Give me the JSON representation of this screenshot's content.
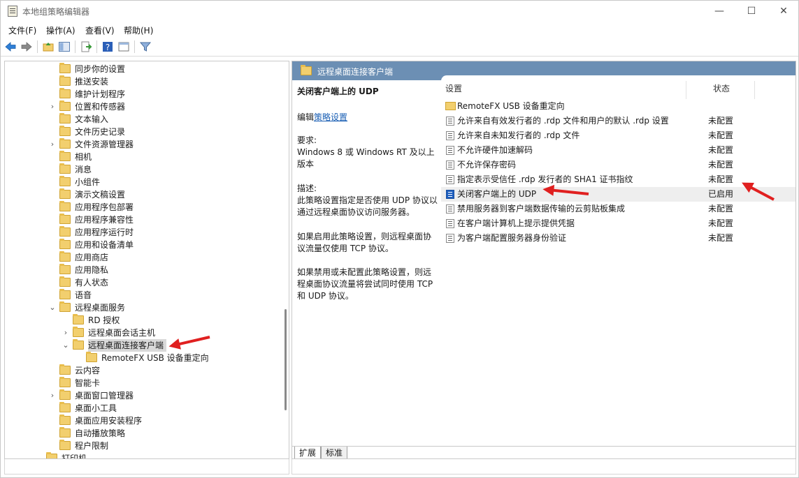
{
  "window": {
    "title": "本地组策略编辑器",
    "minimize": "—",
    "maximize": "☐",
    "close": "✕"
  },
  "menu": [
    {
      "label": "文件(F)"
    },
    {
      "label": "操作(A)"
    },
    {
      "label": "查看(V)"
    },
    {
      "label": "帮助(H)"
    }
  ],
  "tree": {
    "items": [
      {
        "label": "同步你的设置",
        "expander": ""
      },
      {
        "label": "推送安装",
        "expander": ""
      },
      {
        "label": "维护计划程序",
        "expander": ""
      },
      {
        "label": "位置和传感器",
        "expander": "›"
      },
      {
        "label": "文本输入",
        "expander": ""
      },
      {
        "label": "文件历史记录",
        "expander": ""
      },
      {
        "label": "文件资源管理器",
        "expander": "›"
      },
      {
        "label": "相机",
        "expander": ""
      },
      {
        "label": "消息",
        "expander": ""
      },
      {
        "label": "小组件",
        "expander": ""
      },
      {
        "label": "演示文稿设置",
        "expander": ""
      },
      {
        "label": "应用程序包部署",
        "expander": ""
      },
      {
        "label": "应用程序兼容性",
        "expander": ""
      },
      {
        "label": "应用程序运行时",
        "expander": ""
      },
      {
        "label": "应用和设备清单",
        "expander": ""
      },
      {
        "label": "应用商店",
        "expander": ""
      },
      {
        "label": "应用隐私",
        "expander": ""
      },
      {
        "label": "有人状态",
        "expander": ""
      },
      {
        "label": "语音",
        "expander": ""
      },
      {
        "label": "远程桌面服务",
        "expander": "⌄"
      },
      {
        "label": "RD 授权",
        "expander": ""
      },
      {
        "label": "远程桌面会话主机",
        "expander": "›"
      },
      {
        "label": "远程桌面连接客户端",
        "expander": "⌄"
      },
      {
        "label": "RemoteFX USB 设备重定向",
        "expander": ""
      },
      {
        "label": "云内容",
        "expander": ""
      },
      {
        "label": "智能卡",
        "expander": ""
      },
      {
        "label": "桌面窗口管理器",
        "expander": "›"
      },
      {
        "label": "桌面小工具",
        "expander": ""
      },
      {
        "label": "桌面应用安装程序",
        "expander": ""
      },
      {
        "label": "自动播放策略",
        "expander": ""
      },
      {
        "label": "程户限制",
        "expander": ""
      },
      {
        "label": "打印机",
        "expander": ""
      }
    ]
  },
  "right": {
    "header_title": "远程桌面连接客户端",
    "desc": {
      "title": "关闭客户端上的 UDP",
      "edit_prefix": "编辑",
      "edit_link": "策略设置",
      "req_label": "要求:",
      "req_text": "Windows 8 或 Windows RT 及以上版本",
      "desc_label": "描述:",
      "desc_text": "此策略设置指定是否使用 UDP 协议以通过远程桌面协议访问服务器。",
      "enabled_text": "如果启用此策略设置，则远程桌面协议流量仅使用 TCP 协议。",
      "disabled_text": "如果禁用或未配置此策略设置，则远程桌面协议流量将尝试同时使用 TCP 和 UDP 协议。"
    },
    "columns": {
      "setting": "设置",
      "state": "状态"
    },
    "rows": [
      {
        "name": "RemoteFX USB 设备重定向",
        "state": "",
        "kind": "folder"
      },
      {
        "name": "允许来自有效发行者的 .rdp 文件和用户的默认 .rdp 设置",
        "state": "未配置",
        "kind": "policy"
      },
      {
        "name": "允许来自未知发行者的 .rdp 文件",
        "state": "未配置",
        "kind": "policy"
      },
      {
        "name": "不允许硬件加速解码",
        "state": "未配置",
        "kind": "policy"
      },
      {
        "name": "不允许保存密码",
        "state": "未配置",
        "kind": "policy"
      },
      {
        "name": "指定表示受信任 .rdp 发行者的 SHA1 证书指纹",
        "state": "未配置",
        "kind": "policy"
      },
      {
        "name": "关闭客户端上的 UDP",
        "state": "已启用",
        "kind": "policy-enabled"
      },
      {
        "name": "禁用服务器到客户端数据传输的云剪贴板集成",
        "state": "未配置",
        "kind": "policy"
      },
      {
        "name": "在客户端计算机上提示提供凭据",
        "state": "未配置",
        "kind": "policy"
      },
      {
        "name": "为客户端配置服务器身份验证",
        "state": "未配置",
        "kind": "policy"
      }
    ],
    "tabs": [
      {
        "label": "扩展"
      },
      {
        "label": "标准"
      }
    ]
  }
}
